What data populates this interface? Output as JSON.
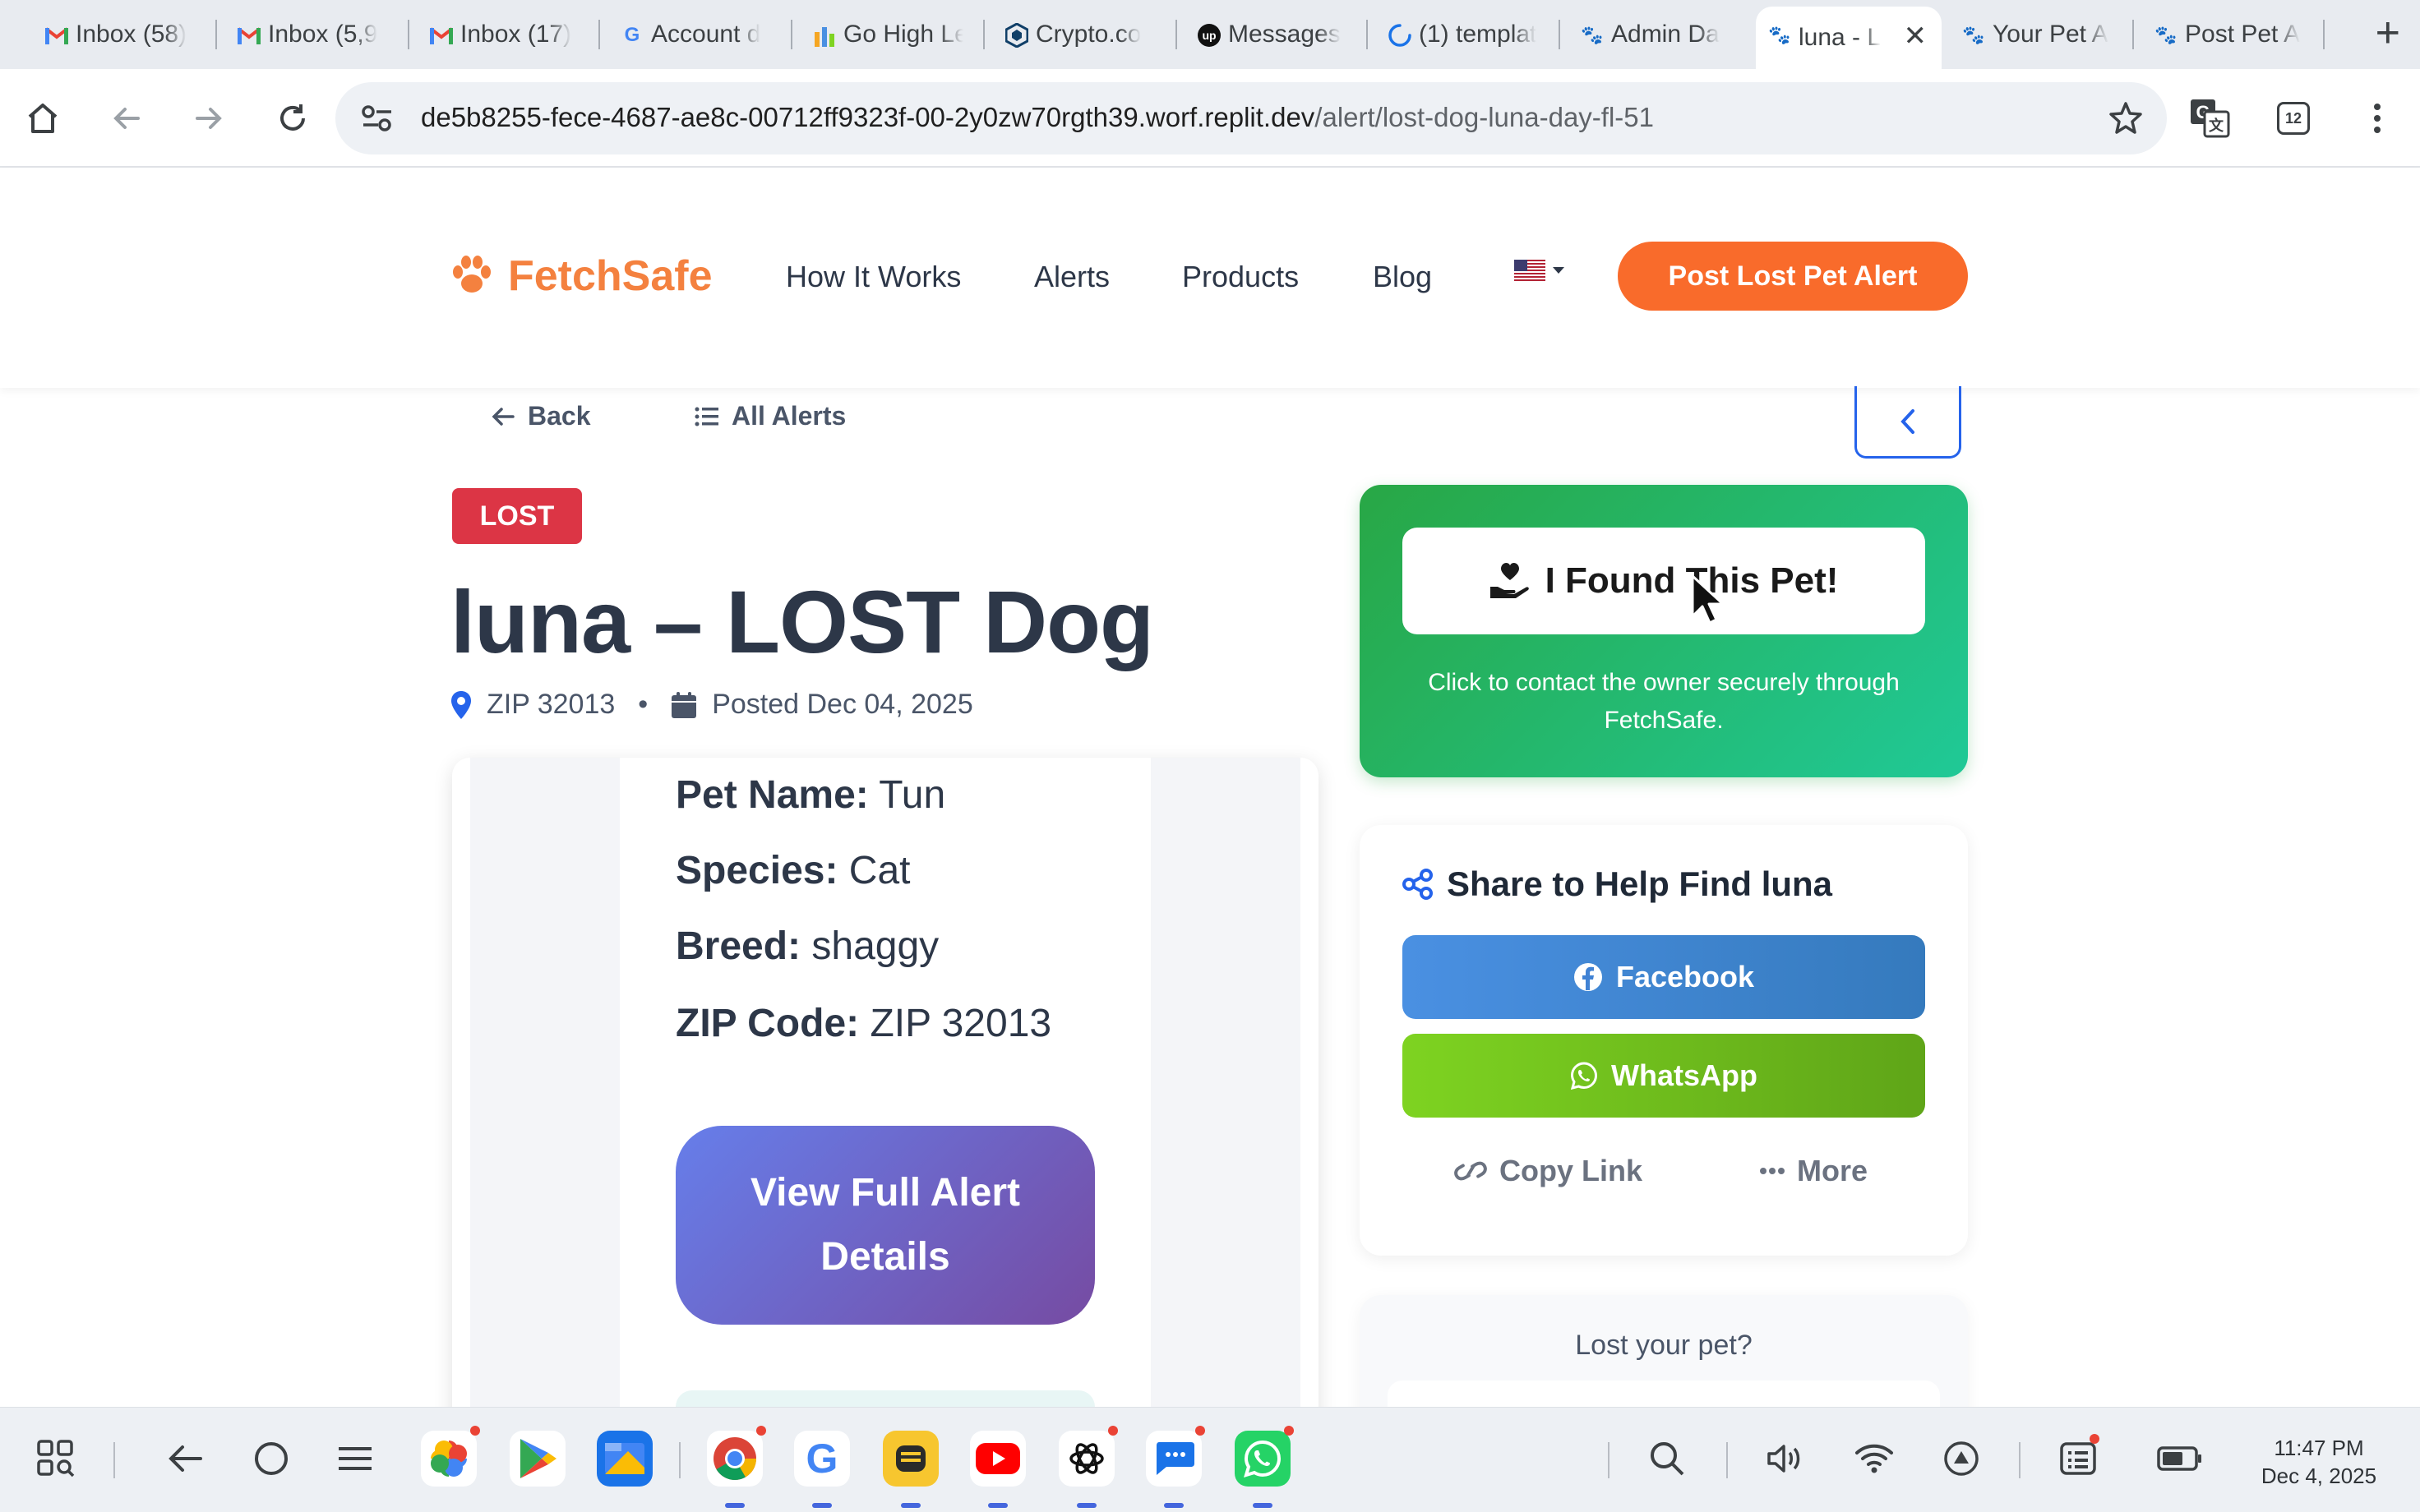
{
  "browser": {
    "tabs": [
      {
        "label": "Inbox (58)",
        "icon": "gmail-icon"
      },
      {
        "label": "Inbox (5,9",
        "icon": "gmail-icon"
      },
      {
        "label": "Inbox (17)",
        "icon": "gmail-icon"
      },
      {
        "label": "Account d",
        "icon": "google-icon"
      },
      {
        "label": "Go High Le",
        "icon": "gohighlevel-icon"
      },
      {
        "label": "Crypto.co",
        "icon": "crypto-icon"
      },
      {
        "label": "Messages",
        "icon": "upwork-icon"
      },
      {
        "label": "(1) templat",
        "icon": "loading-icon"
      },
      {
        "label": "Admin Da",
        "icon": "fetchsafe-favicon"
      },
      {
        "label": "luna - L",
        "icon": "fetchsafe-favicon",
        "active": true
      },
      {
        "label": "Your Pet A",
        "icon": "fetchsafe-favicon"
      },
      {
        "label": "Post Pet A",
        "icon": "fetchsafe-favicon"
      }
    ],
    "url_host": "de5b8255-fece-4687-ae8c-00712ff9323f-00-2y0zw70rgth39.worf.replit.dev",
    "url_path": "/alert/lost-dog-luna-day-fl-51",
    "extension_badge": "12"
  },
  "site": {
    "brand": "FetchSafe",
    "brand_color": "#f4813f",
    "nav": [
      "How It Works",
      "Alerts",
      "Products",
      "Blog"
    ],
    "language_flag": "🇺🇸",
    "cta_label": "Post Lost Pet Alert",
    "cta_color": "#f96b2b"
  },
  "alert": {
    "back_label": "Back",
    "all_alerts_label": "All Alerts",
    "status_badge": "LOST",
    "title": "luna – LOST Dog",
    "zip": "ZIP 32013",
    "posted": "Posted Dec 04, 2025",
    "flyer": {
      "pet_name_label": "Pet Name:",
      "pet_name": "Tun",
      "species_label": "Species:",
      "species": "Cat",
      "breed_label": "Breed:",
      "breed": "shaggy",
      "zip_label": "ZIP Code:",
      "zip": "ZIP 32013",
      "view_button": "View Full Alert Details"
    }
  },
  "sidebar": {
    "found_button": "I Found This Pet!",
    "found_sub": "Click to contact the owner securely through FetchSafe.",
    "share_title": "Share to Help Find luna",
    "facebook": "Facebook",
    "whatsapp": "WhatsApp",
    "copy_link": "Copy Link",
    "more": "More",
    "lost_question": "Lost your pet?"
  },
  "system": {
    "time": "11:47 PM",
    "date": "Dec 4, 2025"
  }
}
